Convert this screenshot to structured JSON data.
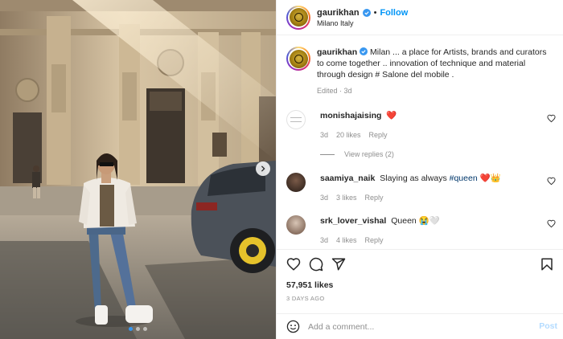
{
  "header": {
    "username": "gaurikhan",
    "separator": "•",
    "follow_label": "Follow",
    "location": "Milano Italy"
  },
  "caption": {
    "username": "gaurikhan",
    "text": "Milan ... a place for Artists, brands and curators to come together .. innovation of technique and material through design # Salone del mobile .",
    "meta": "Edited · 3d"
  },
  "comments": [
    {
      "username": "monishajaising",
      "emoji": "❤️",
      "age": "3d",
      "likes": "20 likes",
      "reply_label": "Reply"
    },
    {
      "username": "saamiya_naik",
      "text": "Slaying as always",
      "hashtag": "#queen",
      "emoji": "❤️👑",
      "age": "3d",
      "likes": "3 likes",
      "reply_label": "Reply"
    },
    {
      "username": "srk_lover_vishal",
      "text": "Queen",
      "emoji": "😭🤍",
      "age": "3d",
      "likes": "4 likes",
      "reply_label": "Reply"
    }
  ],
  "view_replies": "View replies (2)",
  "likes_count": "57,951 likes",
  "post_date": "3 DAYS AGO",
  "add_comment": {
    "placeholder": "Add a comment...",
    "post_label": "Post"
  },
  "carousel": {
    "slide_count": 3,
    "active_index": 0
  },
  "icons": {
    "verified": "verified-badge-icon",
    "like": "heart-outline-icon",
    "comment": "speech-bubble-icon",
    "share": "paper-plane-icon",
    "save": "bookmark-icon",
    "emoji": "smiley-icon",
    "next": "chevron-right-icon"
  },
  "colors": {
    "link_blue": "#0095f6",
    "muted": "#8e8e8e",
    "post_disabled": "#b3dbff",
    "heart_red": "#ed4956"
  }
}
